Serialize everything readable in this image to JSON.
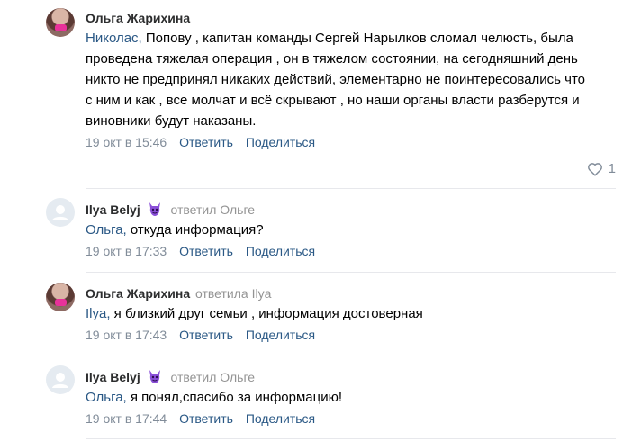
{
  "comments": [
    {
      "author": "Ольга Жарихина",
      "replied_to": "",
      "mention": "Николас,",
      "text": " Попову , капитан команды Сергей Нарылков сломал челюсть, была проведена тяжелая операция , он в тяжелом состоянии, на сегодняшний день никто не предпринял никаких действий, элементарно не поинтересовались что с ним и как , все молчат и всё скрывают , но наши органы власти разберутся и виновники будут наказаны.",
      "date": "19 окт в 15:46",
      "reply_label": "Ответить",
      "share_label": "Поделиться",
      "likes": "1"
    },
    {
      "author": "Ilya Belyj",
      "replied_to": "ответил Ольге",
      "mention": "Ольга,",
      "text": " откуда информация?",
      "date": "19 окт в 17:33",
      "reply_label": "Ответить",
      "share_label": "Поделиться"
    },
    {
      "author": "Ольга Жарихина",
      "replied_to": "ответила Ilya",
      "mention": "Ilya,",
      "text": " я близкий друг семьи , информация достоверная",
      "date": "19 окт в 17:43",
      "reply_label": "Ответить",
      "share_label": "Поделиться"
    },
    {
      "author": "Ilya Belyj",
      "replied_to": "ответил Ольге",
      "mention": "Ольга,",
      "text": " я понял,спасибо за информацию!",
      "date": "19 окт в 17:44",
      "reply_label": "Ответить",
      "share_label": "Поделиться"
    }
  ],
  "icons": {
    "like": "heart-outline-icon",
    "badge": "purple-devil-emoji-icon",
    "default_avatar": "user-silhouette-icon"
  },
  "colors": {
    "link": "#2a5885",
    "meta": "#818c99",
    "badge": "#8a4fd8",
    "mask": "#e8319a"
  }
}
